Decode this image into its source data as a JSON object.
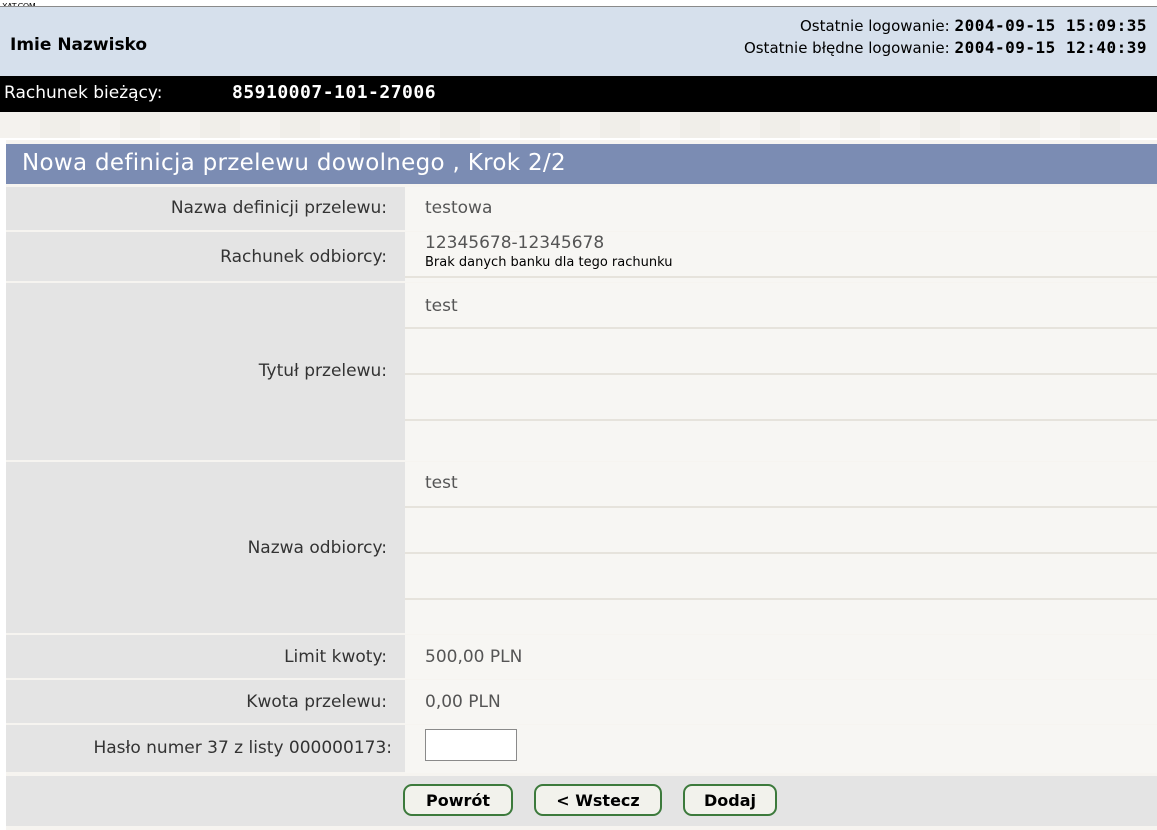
{
  "watermark": "XAT.COM",
  "header": {
    "user_name": "Imie Nazwisko",
    "last_login_label": "Ostatnie logowanie:",
    "last_login_value": "2004-09-15 15:09:35",
    "last_failed_login_label": "Ostatnie błędne logowanie:",
    "last_failed_login_value": "2004-09-15 12:40:39"
  },
  "account": {
    "label": "Rachunek bieżący:",
    "number": "85910007-101-27006"
  },
  "form": {
    "title": "Nowa definicja przelewu dowolnego ,   Krok 2/2",
    "rows": [
      {
        "label": "Nazwa definicji przelewu:",
        "value": "testowa"
      },
      {
        "label": "Rachunek odbiorcy:",
        "value": "12345678-12345678",
        "note": "Brak danych banku dla tego rachunku"
      },
      {
        "label": "Tytuł przelewu:",
        "value": "test"
      },
      {
        "label": "Nazwa odbiorcy:",
        "value": "test"
      },
      {
        "label": "Limit kwoty:",
        "value": "500,00 PLN"
      },
      {
        "label": "Kwota przelewu:",
        "value": "0,00 PLN"
      },
      {
        "label": "Hasło numer 37 z listy 000000173:",
        "value": ""
      }
    ]
  },
  "buttons": {
    "return": "Powrót",
    "back": "< Wstecz",
    "add": "Dodaj"
  },
  "colors": {
    "title_bar": "#7b8cb3",
    "header_bg": "#d6e0ec",
    "account_bar": "#000000",
    "button_border": "#3c7a3c"
  }
}
